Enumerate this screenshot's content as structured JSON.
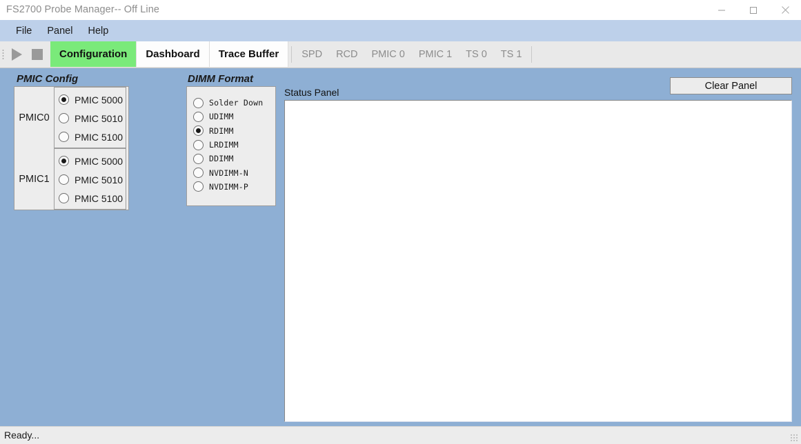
{
  "window": {
    "title": "FS2700 Probe Manager-- Off Line",
    "controls": {
      "minimize": "minimize-icon",
      "maximize": "maximize-icon",
      "close": "close-icon"
    }
  },
  "menubar": {
    "items": [
      {
        "label": "File"
      },
      {
        "label": "Panel"
      },
      {
        "label": "Help"
      }
    ]
  },
  "toolbar": {
    "play_icon": "play-icon",
    "stop_icon": "stop-icon",
    "tabs": [
      {
        "label": "Configuration",
        "selected": true,
        "enabled": true
      },
      {
        "label": "Dashboard",
        "selected": false,
        "enabled": true
      },
      {
        "label": "Trace Buffer",
        "selected": false,
        "enabled": true
      },
      {
        "label": "SPD",
        "selected": false,
        "enabled": false
      },
      {
        "label": "RCD",
        "selected": false,
        "enabled": false
      },
      {
        "label": "PMIC 0",
        "selected": false,
        "enabled": false
      },
      {
        "label": "PMIC 1",
        "selected": false,
        "enabled": false
      },
      {
        "label": "TS 0",
        "selected": false,
        "enabled": false
      },
      {
        "label": "TS 1",
        "selected": false,
        "enabled": false
      }
    ]
  },
  "pmic_config": {
    "title": "PMIC Config",
    "groups": [
      {
        "label": "PMIC0",
        "options": [
          {
            "label": "PMIC 5000",
            "selected": true
          },
          {
            "label": "PMIC 5010",
            "selected": false
          },
          {
            "label": "PMIC 5100",
            "selected": false
          }
        ]
      },
      {
        "label": "PMIC1",
        "options": [
          {
            "label": "PMIC 5000",
            "selected": true
          },
          {
            "label": "PMIC 5010",
            "selected": false
          },
          {
            "label": "PMIC 5100",
            "selected": false
          }
        ]
      }
    ]
  },
  "dimm_format": {
    "title": "DIMM Format",
    "options": [
      {
        "label": "Solder Down",
        "selected": false
      },
      {
        "label": "UDIMM",
        "selected": false
      },
      {
        "label": "RDIMM",
        "selected": true
      },
      {
        "label": "LRDIMM",
        "selected": false
      },
      {
        "label": "DDIMM",
        "selected": false
      },
      {
        "label": "NVDIMM-N",
        "selected": false
      },
      {
        "label": "NVDIMM-P",
        "selected": false
      }
    ]
  },
  "status_panel": {
    "label": "Status Panel",
    "content": "",
    "clear_button": "Clear Panel"
  },
  "statusbar": {
    "text": "Ready..."
  },
  "colors": {
    "window_background": "#8eafd4",
    "menubar": "#bdd0ea",
    "selected_tab": "#7aea7a",
    "groupbox": "#ededed",
    "panel_white": "#ffffff"
  }
}
